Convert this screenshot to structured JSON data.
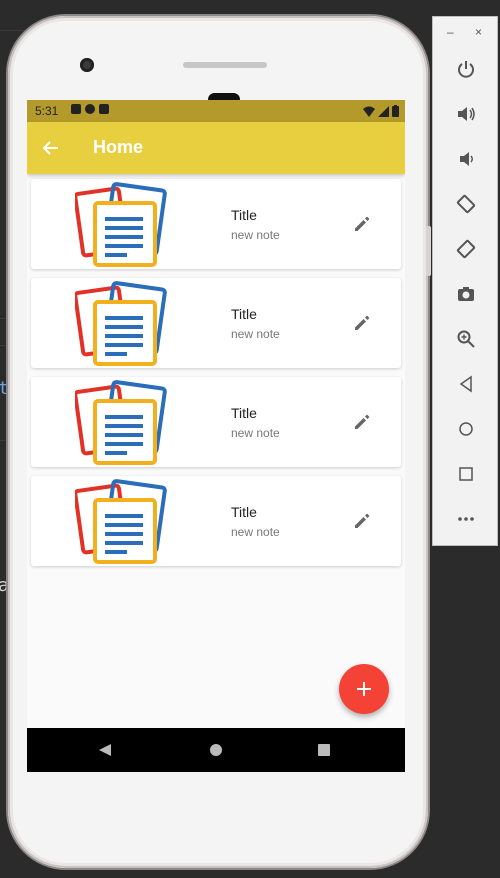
{
  "emulator_panel": {
    "minimize_label": "–",
    "close_label": "×",
    "buttons": [
      "power-icon",
      "volume-up-icon",
      "volume-down-icon",
      "rotate-left-icon",
      "rotate-right-icon",
      "camera-icon",
      "zoom-icon",
      "back-icon",
      "home-icon",
      "overview-icon",
      "more-icon"
    ]
  },
  "status_bar": {
    "time": "5:31"
  },
  "app_bar": {
    "title": "Home"
  },
  "notes": [
    {
      "title": "Title",
      "subtitle": "new note"
    },
    {
      "title": "Title",
      "subtitle": "new note"
    },
    {
      "title": "Title",
      "subtitle": "new note"
    },
    {
      "title": "Title",
      "subtitle": "new note"
    }
  ],
  "colors": {
    "app_bar": "#e8cf3f",
    "status_bar": "#b49a2a",
    "fab": "#f44336",
    "icon_red": "#e23228",
    "icon_blue": "#2a6ebb",
    "icon_yellow": "#f2b01e"
  },
  "fab": {
    "label": "+"
  },
  "ide": {
    "glyph_t": "t",
    "glyph_a": "a"
  }
}
